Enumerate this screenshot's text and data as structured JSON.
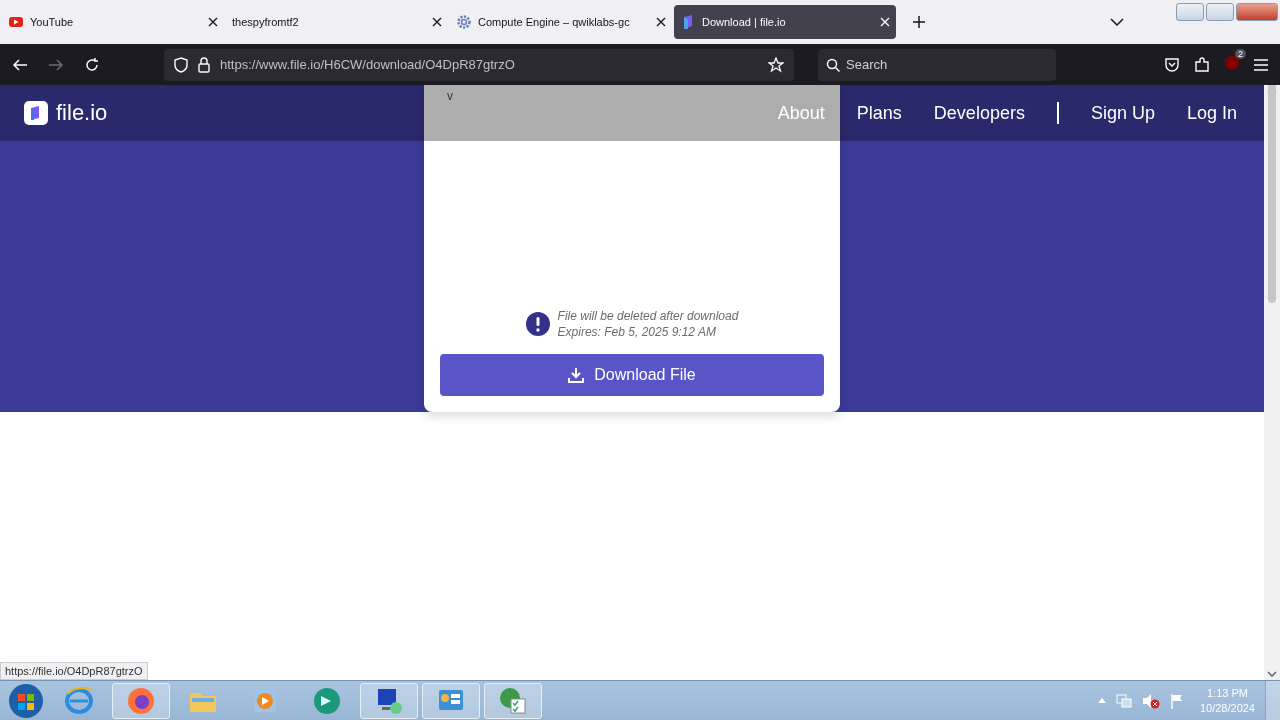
{
  "browser": {
    "tabs": [
      {
        "kind": "video",
        "title": "YouTube",
        "selected": false
      },
      {
        "kind": "none",
        "title": "thespyfromtf2",
        "selected": false
      },
      {
        "kind": "gear",
        "title": "Compute Engine – qwiklabs-gc",
        "selected": false
      },
      {
        "kind": "cube",
        "title": "Download | file.io",
        "selected": true
      }
    ],
    "url": "https://www.file.io/H6CW/download/O4DpR87gtrzO",
    "search": {
      "placeholder": "Search"
    },
    "extension_badge": "2"
  },
  "site": {
    "logo": "file.io",
    "overlay_text": "v",
    "nav": [
      "About",
      "Plans",
      "Developers"
    ],
    "auth": [
      "Sign Up",
      "Log In"
    ],
    "notice": [
      "File will be deleted after download",
      "Expires: Feb 5, 2025 9:12 AM"
    ],
    "download_button": "Download File"
  },
  "status_url": "https://file.io/O4DpR87gtrzO",
  "taskbar": {
    "apps": [
      {
        "kind": "browser-e",
        "open": false
      },
      {
        "kind": "firefox",
        "open": true
      },
      {
        "kind": "folder",
        "open": false
      },
      {
        "kind": "media",
        "open": false
      },
      {
        "kind": "orb",
        "open": false
      },
      {
        "kind": "monitor",
        "open": true
      },
      {
        "kind": "panel",
        "open": true
      },
      {
        "kind": "globe",
        "open": true
      }
    ],
    "time": "1:13 PM",
    "date": "10/28/2024"
  }
}
